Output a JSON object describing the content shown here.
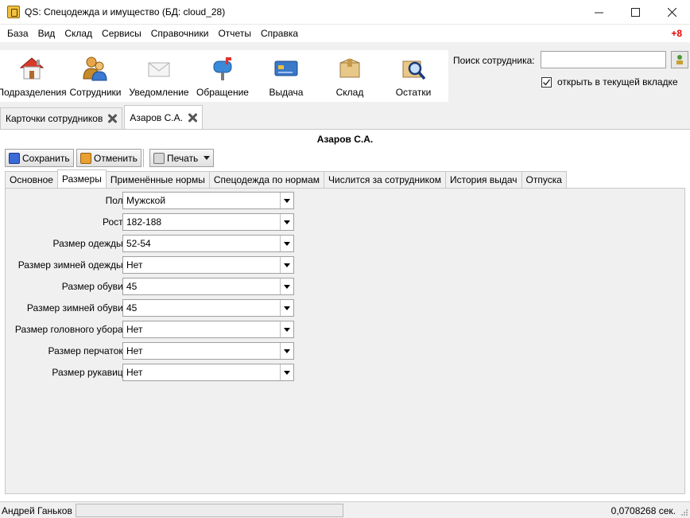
{
  "window": {
    "title": "QS: Спецодежда и имущество (БД: cloud_28)"
  },
  "menu": {
    "items": [
      "База",
      "Вид",
      "Склад",
      "Сервисы",
      "Справочники",
      "Отчеты",
      "Справка"
    ],
    "badge": "+8"
  },
  "toolbar": {
    "buttons": [
      {
        "label": "Подразделения",
        "icon": "house-icon"
      },
      {
        "label": "Сотрудники",
        "icon": "people-icon"
      },
      {
        "label": "Уведомление",
        "icon": "envelope-icon"
      },
      {
        "label": "Обращение",
        "icon": "mailbox-icon"
      },
      {
        "label": "Выдача",
        "icon": "card-icon"
      },
      {
        "label": "Склад",
        "icon": "box-icon"
      },
      {
        "label": "Остатки",
        "icon": "magnifier-icon"
      }
    ]
  },
  "search": {
    "label": "Поиск сотрудника:",
    "value": "",
    "open_in_tab_label": "открыть в текущей вкладке",
    "open_in_tab_checked": true
  },
  "doc_tabs": [
    {
      "label": "Карточки сотрудников",
      "active": false
    },
    {
      "label": "Азаров С.А.",
      "active": true
    }
  ],
  "person": {
    "name": "Азаров С.А."
  },
  "actions": {
    "save": "Сохранить",
    "cancel": "Отменить",
    "print": "Печать"
  },
  "inner_tabs": [
    {
      "label": "Основное",
      "active": false
    },
    {
      "label": "Размеры",
      "active": true
    },
    {
      "label": "Применённые нормы",
      "active": false
    },
    {
      "label": "Спецодежда по нормам",
      "active": false
    },
    {
      "label": "Числится за сотрудником",
      "active": false
    },
    {
      "label": "История выдач",
      "active": false
    },
    {
      "label": "Отпуска",
      "active": false
    }
  ],
  "sizes": {
    "rows": [
      {
        "label": "Пол:",
        "value": "Мужской"
      },
      {
        "label": "Рост:",
        "value": "182-188"
      },
      {
        "label": "Размер одежды:",
        "value": "52-54"
      },
      {
        "label": "Размер зимней одежды:",
        "value": "Нет"
      },
      {
        "label": "Размер обуви:",
        "value": "45"
      },
      {
        "label": "Размер зимней обуви:",
        "value": "45"
      },
      {
        "label": "Размер головного убора:",
        "value": "Нет"
      },
      {
        "label": "Размер перчаток:",
        "value": "Нет"
      },
      {
        "label": "Размер рукавиц:",
        "value": "Нет"
      }
    ]
  },
  "status": {
    "user": "Андрей Ганьков",
    "time": "0,0708268 сек."
  }
}
